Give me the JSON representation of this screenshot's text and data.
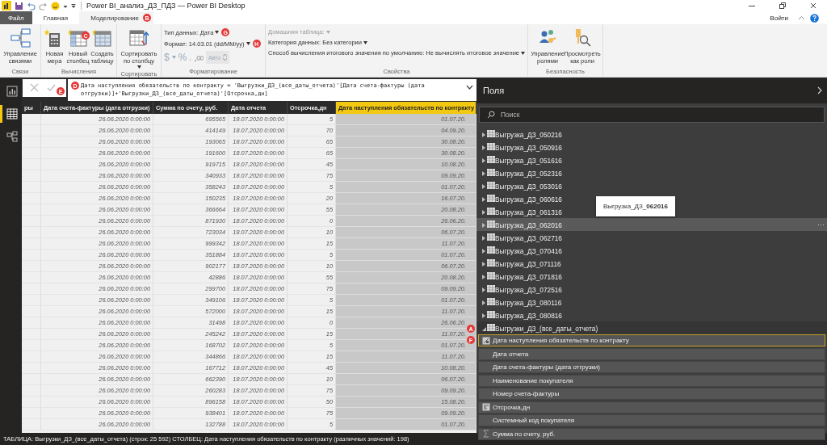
{
  "window": {
    "title": "Power BI_анализ_ДЗ_ПДЗ — Power BI Desktop",
    "sign_in": "Войти"
  },
  "tabs": [
    {
      "label": "Файл",
      "kind": "file",
      "selected": false
    },
    {
      "label": "Главная",
      "kind": "tab",
      "selected": false
    },
    {
      "label": "Моделирование",
      "kind": "tab",
      "selected": true,
      "marker": "B"
    }
  ],
  "ribbon": {
    "groups": [
      {
        "label": "Связи",
        "buttons": [
          {
            "label": "Управление связями",
            "kind": "relations"
          }
        ]
      },
      {
        "label": "Вычисления",
        "buttons": [
          {
            "label": "Новая мера",
            "kind": "calc"
          },
          {
            "label": "Новый столбец",
            "kind": "column",
            "marker": "C"
          },
          {
            "label": "Создать таблицу",
            "kind": "table"
          }
        ]
      },
      {
        "label": "Сортировать",
        "buttons": [
          {
            "label": "Сортировать по столбцу",
            "kind": "sort",
            "dropdown": true
          }
        ]
      },
      {
        "label": "Форматирование",
        "kind": "format",
        "data_type": {
          "label": "Тип данных: Дата",
          "marker": "G"
        },
        "format": {
          "label": "Формат: 14.03.01 (dd/MM/yy)",
          "marker": "H"
        },
        "currency": "$",
        "percent": "%",
        "comma": ",",
        "decimals": "Авто",
        "disabled": true
      },
      {
        "label": "Свойства",
        "kind": "props",
        "items": [
          {
            "label": "Домашняя таблица:",
            "disabled": true
          },
          {
            "label": "Категория данных: Без категории",
            "disabled": false
          },
          {
            "label": "Способ вычисления итогового значения по умолчанию: Не вычислять итоговое значение",
            "disabled": false
          }
        ]
      },
      {
        "label": "Безопасность",
        "buttons": [
          {
            "label": "Управление ролями",
            "kind": "roles"
          },
          {
            "label": "Просмотреть как роли",
            "kind": "viewroles"
          }
        ]
      }
    ]
  },
  "nav": [
    {
      "kind": "report",
      "selected": false
    },
    {
      "kind": "data",
      "selected": true
    },
    {
      "kind": "model",
      "selected": false
    }
  ],
  "formula": {
    "text": "Дата наступления обязательств по контракту = 'Выгрузки_ДЗ_(все_даты_отчета)'[Дата счета-фактуры (дата отгрузки)]+'Выгрузки_ДЗ_(все_даты_отчета)'[Отсрочка,дн]",
    "marker": "D",
    "cancel_marker": "E"
  },
  "table": {
    "columns": [
      {
        "label": "ры",
        "selected": false
      },
      {
        "label": "Дата счета-фактуры (дата отгрузки)",
        "selected": false
      },
      {
        "label": "Сумма по счету, руб.",
        "selected": false
      },
      {
        "label": "Дата отчета",
        "selected": false
      },
      {
        "label": "Отсрочка,дн",
        "selected": false
      },
      {
        "label": "Дата наступления обязательств по контракту",
        "selected": true
      }
    ],
    "rows": [
      {
        "cells": [
          "",
          "26.06.2020 0:00:00",
          "695565",
          "18.07.2020 0:00:00",
          "5",
          "01.07.20."
        ]
      },
      {
        "cells": [
          "",
          "26.06.2020 0:00:00",
          "414149",
          "18.07.2020 0:00:00",
          "70",
          "04.09.20."
        ]
      },
      {
        "cells": [
          "",
          "26.06.2020 0:00:00",
          "193065",
          "18.07.2020 0:00:00",
          "65",
          "30.08.20."
        ]
      },
      {
        "cells": [
          "",
          "26.06.2020 0:00:00",
          "191600",
          "18.07.2020 0:00:00",
          "65",
          "30.08.20."
        ]
      },
      {
        "cells": [
          "",
          "26.06.2020 0:00:00",
          "919715",
          "18.07.2020 0:00:00",
          "45",
          "10.08.20."
        ]
      },
      {
        "cells": [
          "",
          "26.06.2020 0:00:00",
          "340933",
          "18.07.2020 0:00:00",
          "75",
          "09.09.20."
        ]
      },
      {
        "cells": [
          "",
          "26.06.2020 0:00:00",
          "358243",
          "18.07.2020 0:00:00",
          "5",
          "01.07.20."
        ]
      },
      {
        "cells": [
          "",
          "26.06.2020 0:00:00",
          "150235",
          "18.07.2020 0:00:00",
          "20",
          "16.07.20."
        ]
      },
      {
        "cells": [
          "",
          "26.06.2020 0:00:00",
          "366664",
          "18.07.2020 0:00:00",
          "55",
          "20.08.20."
        ]
      },
      {
        "cells": [
          "",
          "26.06.2020 0:00:00",
          "871930",
          "18.07.2020 0:00:00",
          "0",
          "26.06.20."
        ]
      },
      {
        "cells": [
          "",
          "26.06.2020 0:00:00",
          "723034",
          "18.07.2020 0:00:00",
          "10",
          "06.07.20."
        ]
      },
      {
        "cells": [
          "",
          "26.06.2020 0:00:00",
          "999342",
          "18.07.2020 0:00:00",
          "15",
          "11.07.20."
        ]
      },
      {
        "cells": [
          "",
          "26.06.2020 0:00:00",
          "351884",
          "18.07.2020 0:00:00",
          "5",
          "01.07.20."
        ]
      },
      {
        "cells": [
          "",
          "26.06.2020 0:00:00",
          "902177",
          "18.07.2020 0:00:00",
          "10",
          "06.07.20."
        ]
      },
      {
        "cells": [
          "",
          "26.06.2020 0:00:00",
          "42886",
          "18.07.2020 0:00:00",
          "55",
          "20.08.20."
        ]
      },
      {
        "cells": [
          "",
          "26.06.2020 0:00:00",
          "299700",
          "18.07.2020 0:00:00",
          "75",
          "09.09.20."
        ]
      },
      {
        "cells": [
          "",
          "26.06.2020 0:00:00",
          "349106",
          "18.07.2020 0:00:00",
          "5",
          "01.07.20."
        ]
      },
      {
        "cells": [
          "",
          "26.06.2020 0:00:00",
          "572000",
          "18.07.2020 0:00:00",
          "15",
          "11.07.20."
        ]
      },
      {
        "cells": [
          "",
          "26.06.2020 0:00:00",
          "31498",
          "18.07.2020 0:00:00",
          "0",
          "26.06.20."
        ]
      },
      {
        "cells": [
          "",
          "26.06.2020 0:00:00",
          "245242",
          "18.07.2020 0:00:00",
          "15",
          "11.07.20."
        ],
        "marker": "A"
      },
      {
        "cells": [
          "",
          "26.06.2020 0:00:00",
          "168702",
          "18.07.2020 0:00:00",
          "5",
          "01.07.20."
        ],
        "marker": "F"
      },
      {
        "cells": [
          "",
          "26.06.2020 0:00:00",
          "344866",
          "18.07.2020 0:00:00",
          "15",
          "11.07.20."
        ]
      },
      {
        "cells": [
          "",
          "26.06.2020 0:00:00",
          "167712",
          "18.07.2020 0:00:00",
          "45",
          "10.08.20."
        ]
      },
      {
        "cells": [
          "",
          "26.06.2020 0:00:00",
          "662390",
          "18.07.2020 0:00:00",
          "10",
          "06.07.20."
        ]
      },
      {
        "cells": [
          "",
          "26.06.2020 0:00:00",
          "260283",
          "18.07.2020 0:00:00",
          "75",
          "09.09.20."
        ]
      },
      {
        "cells": [
          "",
          "26.06.2020 0:00:00",
          "896158",
          "18.07.2020 0:00:00",
          "50",
          "15.08.20."
        ]
      },
      {
        "cells": [
          "",
          "26.06.2020 0:00:00",
          "938401",
          "18.07.2020 0:00:00",
          "75",
          "09.09.20."
        ]
      },
      {
        "cells": [
          "",
          "26.06.2020 0:00:00",
          "132788",
          "18.07.2020 0:00:00",
          "5",
          "01.07.20."
        ]
      }
    ]
  },
  "fields_panel": {
    "title": "Поля",
    "search": {
      "placeholder": "Поиск"
    },
    "tables": [
      {
        "name": "Выгрузка_ДЗ_050216",
        "expanded": false,
        "hovered": false
      },
      {
        "name": "Выгрузка_ДЗ_050916",
        "expanded": false,
        "hovered": false
      },
      {
        "name": "Выгрузка_ДЗ_051616",
        "expanded": false,
        "hovered": false
      },
      {
        "name": "Выгрузка_ДЗ_052316",
        "expanded": false,
        "hovered": false
      },
      {
        "name": "Выгрузка_ДЗ_053016",
        "expanded": false,
        "hovered": false
      },
      {
        "name": "Выгрузка_ДЗ_060616",
        "expanded": false,
        "hovered": false
      },
      {
        "name": "Выгрузка_ДЗ_061316",
        "expanded": false,
        "hovered": false
      },
      {
        "name": "Выгрузка_ДЗ_062016",
        "expanded": false,
        "hovered": true,
        "tooltip": "Выгрузка_ДЗ_**062016**",
        "more": "···"
      },
      {
        "name": "Выгрузка_ДЗ_062716",
        "expanded": false,
        "hovered": false
      },
      {
        "name": "Выгрузка_ДЗ_070416",
        "expanded": false,
        "hovered": false
      },
      {
        "name": "Выгрузка_ДЗ_071116",
        "expanded": false,
        "hovered": false
      },
      {
        "name": "Выгрузка_ДЗ_071816",
        "expanded": false,
        "hovered": false
      },
      {
        "name": "Выгрузка_ДЗ_072516",
        "expanded": false,
        "hovered": false
      },
      {
        "name": "Выгрузка_ДЗ_080116",
        "expanded": false,
        "hovered": false
      },
      {
        "name": "Выгрузка_ДЗ_080816",
        "expanded": false,
        "hovered": false
      },
      {
        "name": "Выгрузки_ДЗ_(все_даты_отчета)",
        "expanded": true,
        "hovered": false,
        "children": [
          {
            "name": "Дата наступления обязательств по контракту",
            "kind": "calculated",
            "selected": true
          },
          {
            "name": "Дата отчета",
            "kind": "plain",
            "selected": false
          },
          {
            "name": "Дата счета-фактуры (дата отгрузки)",
            "kind": "plain",
            "selected": false
          },
          {
            "name": "Наименование покупателя",
            "kind": "plain",
            "selected": false
          },
          {
            "name": "Номер счета-фактуры",
            "kind": "plain",
            "selected": false
          },
          {
            "name": "Отсрочка,дн",
            "kind": "numeric",
            "selected": false
          },
          {
            "name": "Системный код покупателя",
            "kind": "plain",
            "selected": false
          },
          {
            "name": "Сумма по счету, руб.",
            "kind": "sum",
            "selected": false
          }
        ]
      }
    ]
  },
  "status_bar": "ТАБЛИЦА: Выгрузки_ДЗ_(все_даты_отчета) (строк: 25 592) СТОЛБЕЦ: Дата наступления обязательств по контракту (различных значений: 198)"
}
